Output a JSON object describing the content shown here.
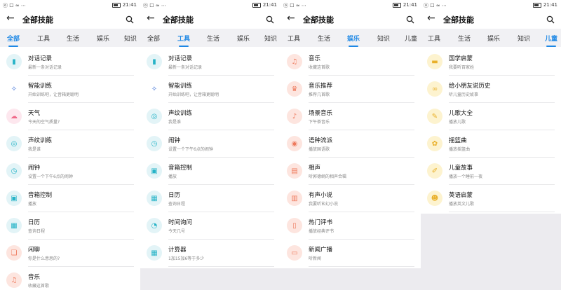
{
  "status_time": "21:41",
  "screens": [
    {
      "status_left": "ⓞ ☐ ≈ ⋯",
      "title": "全部技能",
      "tabs": [
        {
          "label": "全部",
          "active": true
        },
        {
          "label": "工具",
          "active": false
        },
        {
          "label": "生活",
          "active": false
        },
        {
          "label": "娱乐",
          "active": false
        },
        {
          "label": "知识",
          "active": false
        }
      ],
      "rows": [
        {
          "name": "对话记录",
          "sub": "最新一条对话记录",
          "icon": "voice-icon",
          "color": "#e3f4f7",
          "fg": "#26b3c7"
        },
        {
          "name": "智能训练",
          "sub": "开始训练吧，让音箱更聪明",
          "icon": "wand-icon",
          "color": "#ffffff",
          "fg": "#3c70d8"
        },
        {
          "name": "天气",
          "sub": "今天的空气质量?",
          "icon": "weather-icon",
          "color": "#fde7ee",
          "fg": "#f06a8a"
        },
        {
          "name": "声纹训练",
          "sub": "我是谁",
          "icon": "fingerprint-icon",
          "color": "#e3f4f7",
          "fg": "#26b3c7"
        },
        {
          "name": "闹钟",
          "sub": "设置一个下午6点的闹钟",
          "icon": "alarm-icon",
          "color": "#e3f4f7",
          "fg": "#26b3c7"
        },
        {
          "name": "音箱控制",
          "sub": "播放",
          "icon": "speaker-control-icon",
          "color": "#e3f4f7",
          "fg": "#26b3c7"
        },
        {
          "name": "日历",
          "sub": "查询日程",
          "icon": "calendar-icon",
          "color": "#e3f4f7",
          "fg": "#26b3c7"
        },
        {
          "name": "闲聊",
          "sub": "你是什么意思的?",
          "icon": "chat-icon",
          "color": "#fde5df",
          "fg": "#ee7a5d"
        },
        {
          "name": "音乐",
          "sub": "收藏这首歌",
          "icon": "music-icon",
          "color": "#fde5df",
          "fg": "#ee7a5d"
        }
      ]
    },
    {
      "status_left": "ⓞ ☐ ≈ ⋯",
      "title": "全部技能",
      "tabs": [
        {
          "label": "全部",
          "active": false
        },
        {
          "label": "工具",
          "active": true
        },
        {
          "label": "生活",
          "active": false
        },
        {
          "label": "娱乐",
          "active": false
        },
        {
          "label": "知识",
          "active": false
        }
      ],
      "rows": [
        {
          "name": "对话记录",
          "sub": "最新一条对话记录",
          "icon": "voice-icon",
          "color": "#e3f4f7",
          "fg": "#26b3c7"
        },
        {
          "name": "智能训练",
          "sub": "开始训练吧，让音箱更聪明",
          "icon": "wand-icon",
          "color": "#ffffff",
          "fg": "#3c70d8"
        },
        {
          "name": "声纹训练",
          "sub": "我是谁",
          "icon": "fingerprint-icon",
          "color": "#e3f4f7",
          "fg": "#26b3c7"
        },
        {
          "name": "闹钟",
          "sub": "设置一个下午6点的闹钟",
          "icon": "alarm-icon",
          "color": "#e3f4f7",
          "fg": "#26b3c7"
        },
        {
          "name": "音箱控制",
          "sub": "播放",
          "icon": "speaker-control-icon",
          "color": "#e3f4f7",
          "fg": "#26b3c7"
        },
        {
          "name": "日历",
          "sub": "查询日程",
          "icon": "calendar-icon",
          "color": "#e3f4f7",
          "fg": "#26b3c7"
        },
        {
          "name": "时间询问",
          "sub": "今天几号",
          "icon": "clock-icon",
          "color": "#e3f4f7",
          "fg": "#26b3c7"
        },
        {
          "name": "计算器",
          "sub": "1加15加6等于多少",
          "icon": "calculator-icon",
          "color": "#e3f4f7",
          "fg": "#26b3c7"
        }
      ]
    },
    {
      "status_left": "ⓞ ☐ ≈ ⋯",
      "title": "全部技能",
      "tabs": [
        {
          "label": "工具",
          "active": false
        },
        {
          "label": "生活",
          "active": false
        },
        {
          "label": "娱乐",
          "active": true
        },
        {
          "label": "知识",
          "active": false
        },
        {
          "label": "儿童",
          "active": false
        }
      ],
      "rows": [
        {
          "name": "音乐",
          "sub": "收藏这首歌",
          "icon": "music-icon",
          "color": "#fde5df",
          "fg": "#ee7a5d"
        },
        {
          "name": "音乐推荐",
          "sub": "推荐几首歌",
          "icon": "music-recommend-icon",
          "color": "#fde5df",
          "fg": "#ee7a5d"
        },
        {
          "name": "场景音乐",
          "sub": "下午茶音乐",
          "icon": "scene-music-icon",
          "color": "#fde5df",
          "fg": "#ee7a5d"
        },
        {
          "name": "语种流派",
          "sub": "播放国语歌",
          "icon": "genre-icon",
          "color": "#fde5df",
          "fg": "#ee7a5d"
        },
        {
          "name": "相声",
          "sub": "听郭德纲的相声合辑",
          "icon": "crosstalk-icon",
          "color": "#fde5df",
          "fg": "#ee7a5d"
        },
        {
          "name": "有声小说",
          "sub": "我要听玄幻小说",
          "icon": "audiobook-icon",
          "color": "#fde5df",
          "fg": "#ee7a5d"
        },
        {
          "name": "热门评书",
          "sub": "播放经典评书",
          "icon": "storytelling-icon",
          "color": "#fde5df",
          "fg": "#ee7a5d"
        },
        {
          "name": "新闻广播",
          "sub": "听新闻",
          "icon": "radio-icon",
          "color": "#fde5df",
          "fg": "#ee7a5d"
        }
      ]
    },
    {
      "status_left": "ⓞ ☐ ≈ ⋯",
      "title": "全部技能",
      "tabs": [
        {
          "label": "工具",
          "active": false
        },
        {
          "label": "生活",
          "active": false
        },
        {
          "label": "娱乐",
          "active": false
        },
        {
          "label": "知识",
          "active": false
        },
        {
          "label": "儿童",
          "active": true
        }
      ],
      "rows": [
        {
          "name": "国学启蒙",
          "sub": "我要听百家姓",
          "icon": "classics-icon",
          "color": "#fdf3cf",
          "fg": "#e9b02a"
        },
        {
          "name": "给小朋友说历史",
          "sub": "听儿童历史故事",
          "icon": "history-icon",
          "color": "#fdf3cf",
          "fg": "#e9b02a"
        },
        {
          "name": "儿歌大全",
          "sub": "播放儿歌",
          "icon": "kids-song-icon",
          "color": "#fdf3cf",
          "fg": "#e9b02a"
        },
        {
          "name": "摇篮曲",
          "sub": "播放摇篮曲",
          "icon": "lullaby-icon",
          "color": "#fdf3cf",
          "fg": "#e9b02a"
        },
        {
          "name": "儿童故事",
          "sub": "播放一个睡前一夜",
          "icon": "kids-story-icon",
          "color": "#fdf3cf",
          "fg": "#e9b02a"
        },
        {
          "name": "英语启蒙",
          "sub": "播放英文儿歌",
          "icon": "english-icon",
          "color": "#fdf3cf",
          "fg": "#e9b02a"
        }
      ]
    }
  ]
}
